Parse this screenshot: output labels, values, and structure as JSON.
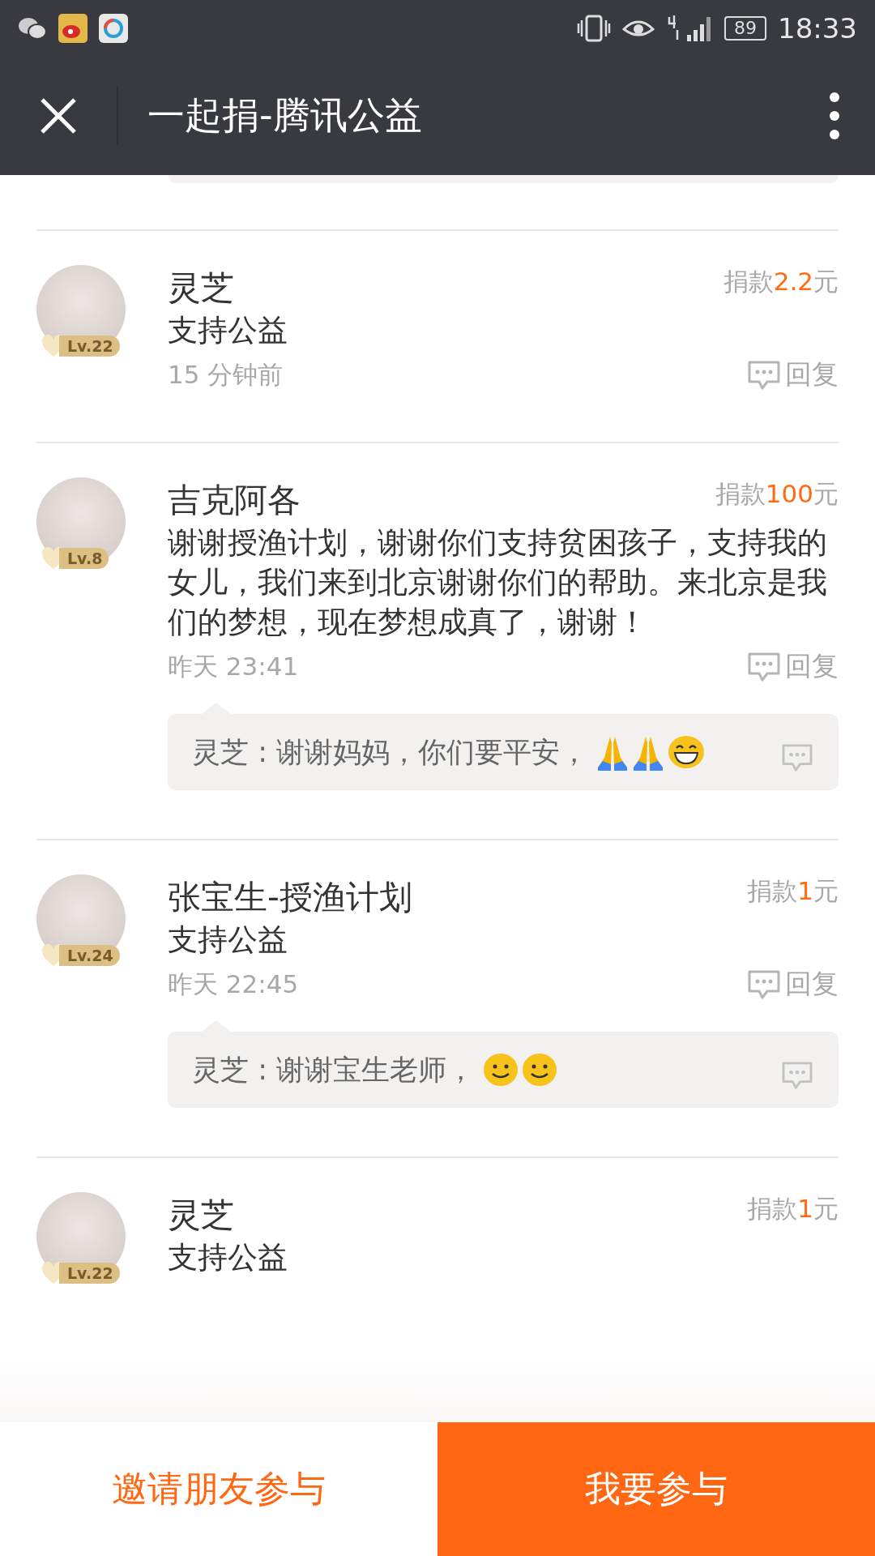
{
  "status_bar": {
    "battery": "89",
    "time": "18:33"
  },
  "header": {
    "title": "一起捐-腾讯公益"
  },
  "comments": [
    {
      "name": "灵芝",
      "level": "Lv.22",
      "donation": {
        "prefix": "捐款",
        "amount": "2.2",
        "suffix": "元"
      },
      "message": "支持公益",
      "time": "15 分钟前",
      "reply_label": "回复"
    },
    {
      "name": "吉克阿各",
      "level": "Lv.8",
      "donation": {
        "prefix": "捐款",
        "amount": "100",
        "suffix": "元"
      },
      "message": "谢谢授渔计划，谢谢你们支持贫困孩子，支持我的女儿，我们来到北京谢谢你们的帮助。来北京是我们的梦想，现在梦想成真了，谢谢！",
      "time": "昨天 23:41",
      "reply_label": "回复",
      "replies": [
        {
          "author": "灵芝",
          "separator": " : ",
          "text": "谢谢妈妈，你们要平安，",
          "emojis": [
            {
              "kind": "folded-hands"
            },
            {
              "kind": "folded-hands"
            },
            {
              "kind": "grin"
            }
          ]
        }
      ]
    },
    {
      "name": "张宝生-授渔计划",
      "level": "Lv.24",
      "donation": {
        "prefix": "捐款",
        "amount": "1",
        "suffix": "元"
      },
      "message": "支持公益",
      "time": "昨天 22:45",
      "reply_label": "回复",
      "replies": [
        {
          "author": "灵芝",
          "separator": " : ",
          "text": "谢谢宝生老师，",
          "emojis": [
            {
              "kind": "smile"
            },
            {
              "kind": "smile"
            }
          ]
        }
      ]
    },
    {
      "name": "灵芝",
      "level": "Lv.22",
      "donation": {
        "prefix": "捐款",
        "amount": "1",
        "suffix": "元"
      },
      "message": "支持公益"
    }
  ],
  "actions": [
    {
      "label": "邀请朋友参与",
      "kind": "secondary"
    },
    {
      "label": "我要参与",
      "kind": "primary"
    }
  ]
}
